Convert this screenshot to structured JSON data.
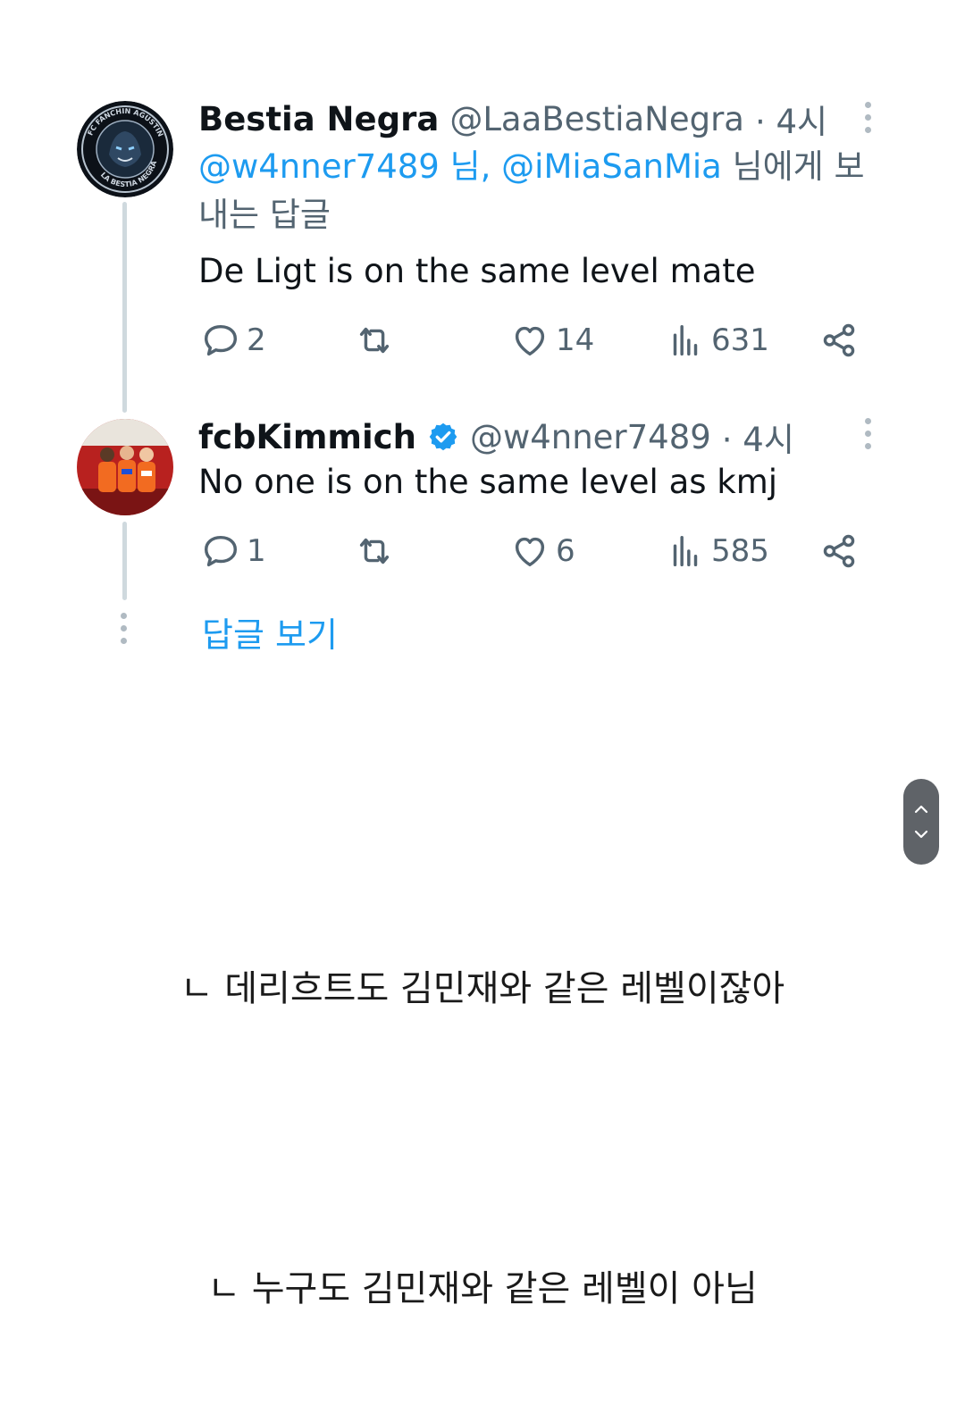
{
  "tweets": [
    {
      "name": "Bestia Negra",
      "handle": "@LaaBestiaNegra",
      "time": "· 4시",
      "reply_mention_1": "@w4nner7489 님,",
      "reply_mention_2": "@iMiaSanMia",
      "reply_suffix": " 님에게 보내는 답글",
      "text": "De Ligt is on the same level mate",
      "replies": "2",
      "likes": "14",
      "views": "631",
      "avatar_icon": "gorilla-crest-logo",
      "avatar_text": "FC FANCHIN AGUSTIN · LA BESTIA NEGRA"
    },
    {
      "name": "fcbKimmich",
      "handle": "@w4nner7489",
      "time": "· 4시",
      "text": "No one is on the same level as kmj",
      "replies": "1",
      "likes": "6",
      "views": "585",
      "verified": true,
      "avatar_icon": "players-photo"
    }
  ],
  "show_replies_label": "답글 보기",
  "captions": [
    "ㄴ 데리흐트도 김민재와 같은 레벨이잖아",
    "ㄴ 누구도 김민재와 같은 레벨이 아님"
  ],
  "colors": {
    "accent": "#1d9bf0",
    "secondary_text": "#536471",
    "thread_line": "#cfd9de"
  }
}
